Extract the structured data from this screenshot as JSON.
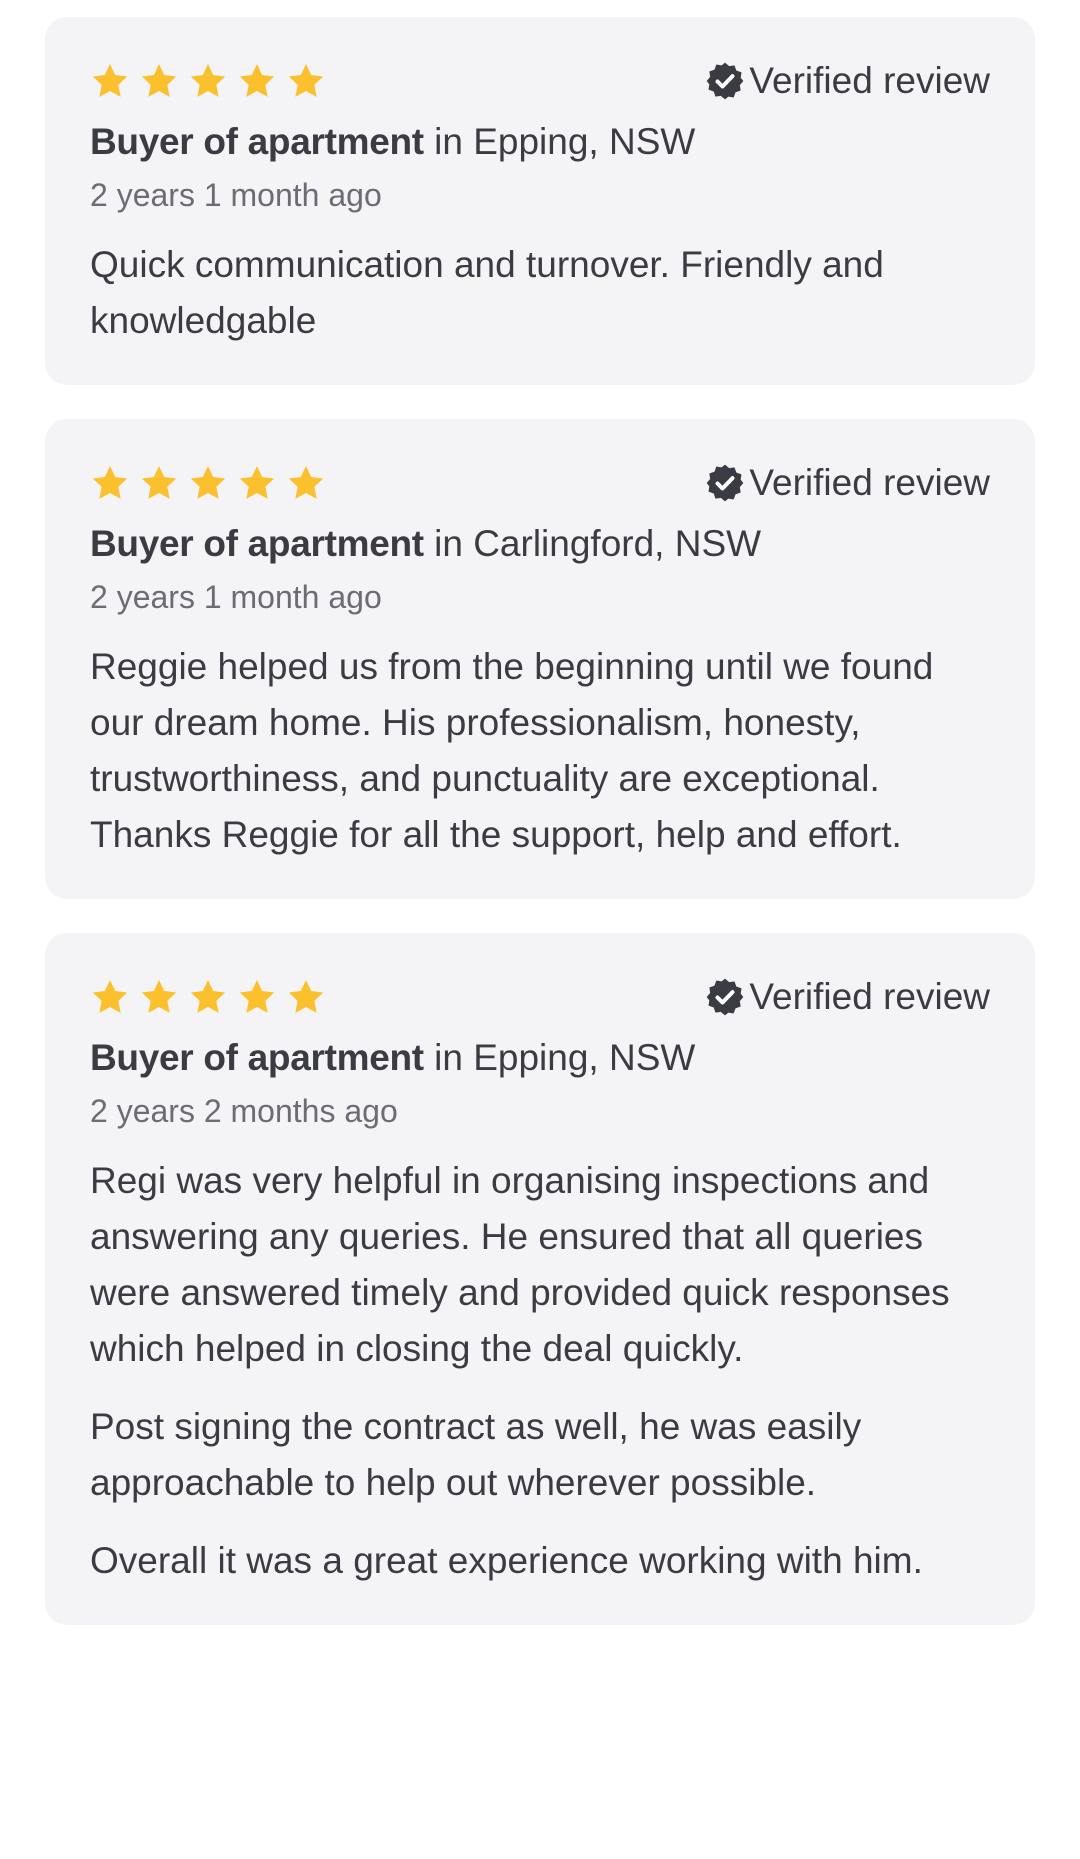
{
  "reviews": [
    {
      "rating": 5,
      "verified_label": "Verified review",
      "role": "Buyer of apartment",
      "location": " in Epping, NSW",
      "date": "2 years 1 month ago",
      "paragraphs": [
        "Quick communication and turnover. Friendly and knowledgable"
      ]
    },
    {
      "rating": 5,
      "verified_label": "Verified review",
      "role": "Buyer of apartment",
      "location": " in Carlingford, NSW",
      "date": "2 years 1 month ago",
      "paragraphs": [
        "Reggie helped us from the beginning until we found our dream home. His professionalism, honesty, trustworthiness, and punctuality are exceptional. Thanks Reggie for all the support, help and effort."
      ]
    },
    {
      "rating": 5,
      "verified_label": "Verified review",
      "role": "Buyer of apartment",
      "location": " in Epping, NSW",
      "date": "2 years 2 months ago",
      "paragraphs": [
        "Regi was very helpful in organising inspections and answering any queries. He ensured that all queries were answered timely and provided quick responses which helped in closing the deal quickly.",
        "Post signing the contract as well, he was easily approachable to help out wherever possible.",
        "Overall it was a great experience working with him."
      ]
    }
  ],
  "colors": {
    "star": "#fbc02d",
    "badge": "#3b3b44",
    "card": "#f4f4f6"
  },
  "icons": {
    "star": "star-icon",
    "verified": "verified-badge-icon"
  }
}
